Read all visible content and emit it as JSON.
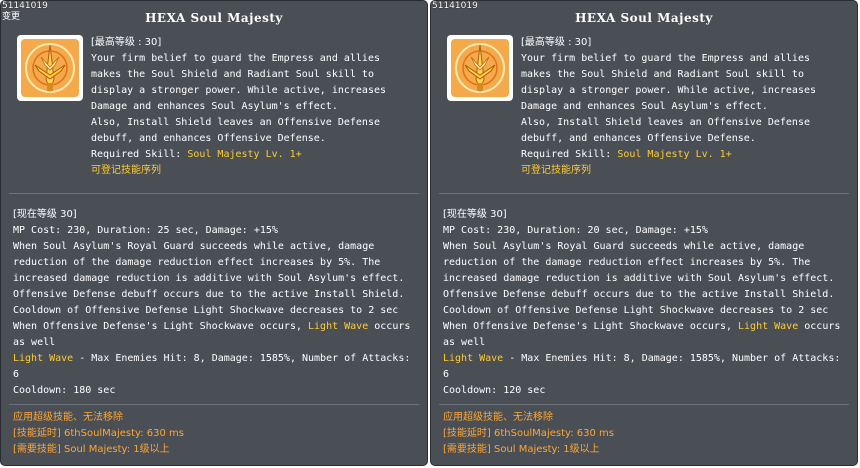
{
  "panels": [
    {
      "id": "51141019",
      "tag": "变更",
      "title": "HEXA Soul Majesty",
      "level_header": "[最高等级 : 30]",
      "desc_lines": [
        "Your firm belief to guard the Empress and allies",
        "makes the Soul Shield and Radiant Soul skill to",
        "display a stronger power. While active, increases",
        "Damage and enhances Soul Asylum's effect.",
        "Also, Install Shield leaves an Offensive Defense",
        "debuff, and enhances Offensive Defense."
      ],
      "required_label": "Required Skill: ",
      "required_value": "Soul Majesty Lv. 1+",
      "registrable": "可登记技能序列",
      "current_level": "[现在等级 30]",
      "stats": "MP Cost: 230, Duration: 25 sec, Damage: +15%",
      "effect_lines": [
        "When Soul Asylum's Royal Guard succeeds while active, damage",
        "reduction of the damage reduction effect increases by 5%. The",
        "increased damage reduction is additive with Soul Asylum's effect.",
        "Offensive Defense debuff occurs due to the active Install Shield.",
        "Cooldown of Offensive Defense Light Shockwave decreases to 2 sec"
      ],
      "occurs_prefix": "When Offensive Defense's Light Shockwave occurs, ",
      "occurs_highlight": "Light Wave",
      "occurs_suffix": " occurs",
      "as_well": "as well",
      "lightwave_name": "Light Wave",
      "lightwave_detail": " - Max Enemies Hit: 8, Damage: 1585%, Number of Attacks:",
      "lightwave_attacks": "6",
      "cooldown": "Cooldown: 180 sec",
      "footer": [
        "应用超级技能、无法移除",
        "[技能延时] 6thSoulMajesty: 630 ms",
        "[需要技能] Soul Majesty: 1级以上"
      ]
    },
    {
      "id": "51141019",
      "tag": "",
      "title": "HEXA Soul Majesty",
      "level_header": "[最高等级 : 30]",
      "desc_lines": [
        "Your firm belief to guard the Empress and allies",
        "makes the Soul Shield and Radiant Soul skill to",
        "display a stronger power. While active, increases",
        "Damage and enhances Soul Asylum's effect.",
        "Also, Install Shield leaves an Offensive Defense",
        "debuff, and enhances Offensive Defense."
      ],
      "required_label": "Required Skill: ",
      "required_value": "Soul Majesty Lv. 1+",
      "registrable": "可登记技能序列",
      "current_level": "[现在等级 30]",
      "stats": "MP Cost: 230, Duration: 20 sec, Damage: +15%",
      "effect_lines": [
        "When Soul Asylum's Royal Guard succeeds while active, damage",
        "reduction of the damage reduction effect increases by 5%. The",
        "increased damage reduction is additive with Soul Asylum's effect.",
        "Offensive Defense debuff occurs due to the active Install Shield.",
        "Cooldown of Offensive Defense Light Shockwave decreases to 2 sec"
      ],
      "occurs_prefix": "When Offensive Defense's Light Shockwave occurs, ",
      "occurs_highlight": "Light Wave",
      "occurs_suffix": " occurs",
      "as_well": "as well",
      "lightwave_name": "Light Wave",
      "lightwave_detail": " - Max Enemies Hit: 8, Damage: 1585%, Number of Attacks:",
      "lightwave_attacks": "6",
      "cooldown": "Cooldown: 120 sec",
      "footer": [
        "应用超级技能、无法移除",
        "[技能延时] 6thSoulMajesty: 630 ms",
        "[需要技能] Soul Majesty: 1级以上"
      ]
    }
  ],
  "colors": {
    "panel_bg": "#4a4e55",
    "highlight": "#ffcc33",
    "footer_text": "#ffa633",
    "separator": "#6c7077"
  },
  "icon": "soul-majesty-icon"
}
